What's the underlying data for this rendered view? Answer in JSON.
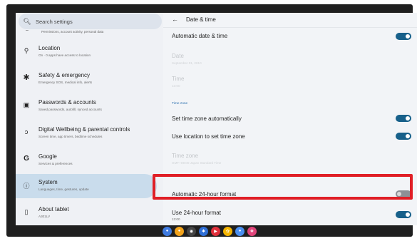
{
  "search": {
    "placeholder": "Search settings"
  },
  "clipped_item": {
    "subtitle": "Permissions, account activity, personal data"
  },
  "sidebar": {
    "items": [
      {
        "title": "Location",
        "subtitle": "On · 0 apps have access to location",
        "icon": "location-pin-icon"
      },
      {
        "title": "Safety & emergency",
        "subtitle": "Emergency SOS, medical info, alerts",
        "icon": "asterisk-icon"
      },
      {
        "title": "Passwords & accounts",
        "subtitle": "Saved passwords, autofill, synced accounts",
        "icon": "account-card-icon"
      },
      {
        "title": "Digital Wellbeing & parental controls",
        "subtitle": "Screen time, app timers, bedtime schedules",
        "icon": "wellbeing-icon"
      },
      {
        "title": "Google",
        "subtitle": "Services & preferences",
        "icon": "google-icon"
      },
      {
        "title": "System",
        "subtitle": "Languages, time, gestures, update",
        "icon": "info-icon"
      },
      {
        "title": "About tablet",
        "subtitle": "A301LV",
        "icon": "tablet-icon"
      }
    ]
  },
  "header": {
    "back": "←",
    "title": "Date & time"
  },
  "settings": {
    "auto_date_time": "Automatic date & time",
    "date_title": "Date",
    "date_value": "September 01, 2010",
    "time_title": "Time",
    "time_value": "13:00",
    "timezone_section": "Time zone",
    "set_tz_auto": "Set time zone automatically",
    "use_location_tz": "Use location to set time zone",
    "tz_title": "Time zone",
    "tz_value": "GMT+09:00 Japan Standard Time",
    "auto_24h": "Automatic 24-hour format",
    "use_24h": "Use 24-hour format",
    "use_24h_value": "13:00"
  },
  "toggles": {
    "auto_date_time": true,
    "set_tz_auto": true,
    "use_location_tz": true,
    "auto_24h": false,
    "use_24h": true
  },
  "colors": {
    "accent": "#17608a",
    "highlight": "#e01f26",
    "selected_bg": "#c9dcec"
  },
  "taskbar": {
    "apps": [
      {
        "name": "chrome-app-icon",
        "color": "#3f7be0",
        "glyph": "●"
      },
      {
        "name": "orange-app-icon",
        "color": "#f2a31b",
        "glyph": "●"
      },
      {
        "name": "camera-app-icon",
        "color": "#333333",
        "glyph": "◉"
      },
      {
        "name": "settings-app-icon",
        "color": "#2f6fd6",
        "glyph": "✱"
      },
      {
        "name": "red-app-icon",
        "color": "#e0303c",
        "glyph": "▶"
      },
      {
        "name": "photos-app-icon",
        "color": "#f4b400",
        "glyph": "✿"
      },
      {
        "name": "blue-app-icon",
        "color": "#4a8ff0",
        "glyph": "●"
      },
      {
        "name": "colorful-app-icon",
        "color": "#e0457b",
        "glyph": "❖"
      }
    ]
  }
}
